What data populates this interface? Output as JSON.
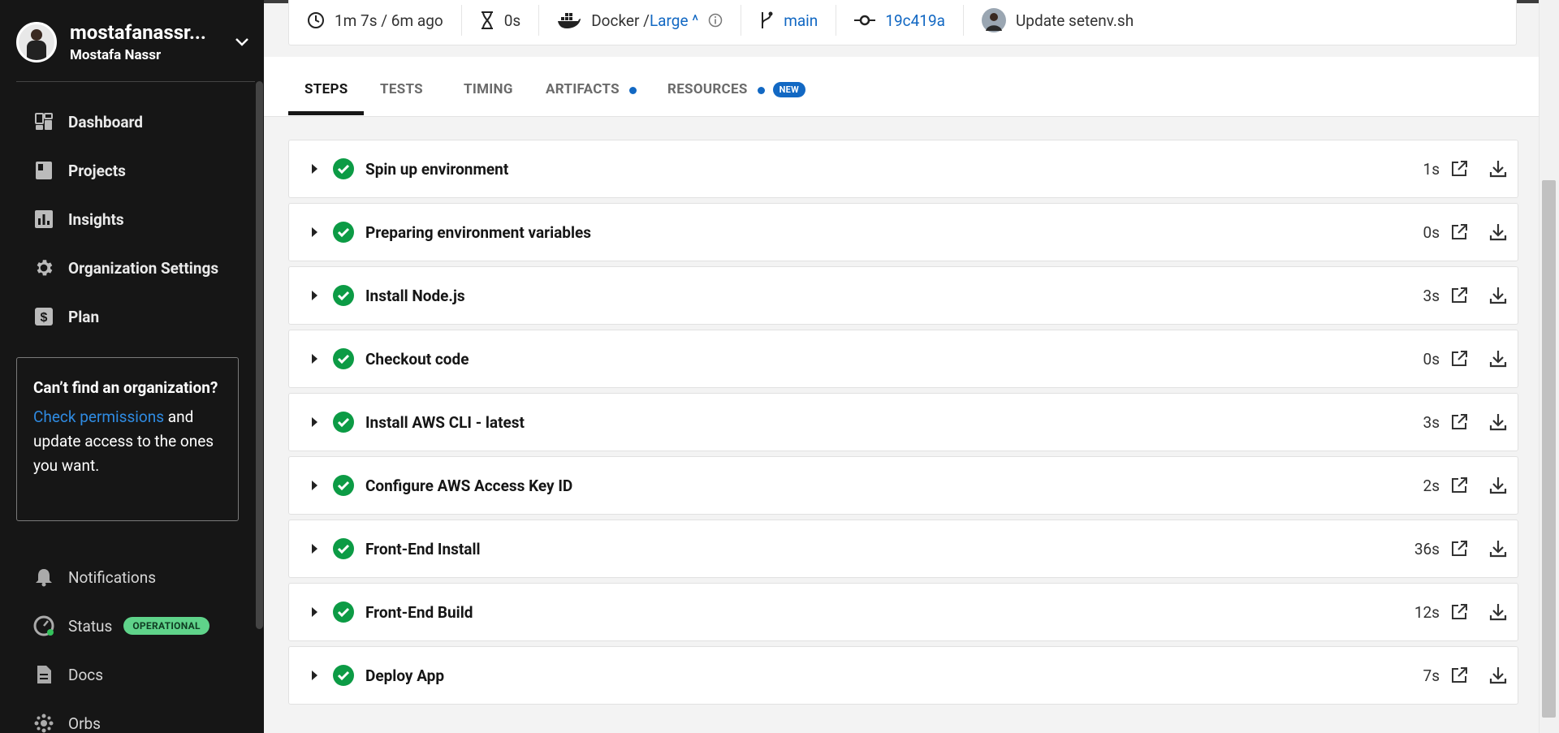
{
  "org": {
    "name": "mostafanassr...",
    "user": "Mostafa Nassr"
  },
  "nav": {
    "items": [
      {
        "label": "Dashboard",
        "icon": "dashboard-icon"
      },
      {
        "label": "Projects",
        "icon": "projects-icon"
      },
      {
        "label": "Insights",
        "icon": "insights-icon"
      },
      {
        "label": "Organization Settings",
        "icon": "gear-icon"
      },
      {
        "label": "Plan",
        "icon": "dollar-icon"
      }
    ],
    "bottom": [
      {
        "label": "Notifications",
        "icon": "bell-icon"
      },
      {
        "label": "Status",
        "icon": "gauge-icon",
        "badge": "OPERATIONAL"
      },
      {
        "label": "Docs",
        "icon": "document-icon"
      },
      {
        "label": "Orbs",
        "icon": "orbs-icon"
      }
    ]
  },
  "callout": {
    "title": "Can’t find an organization?",
    "link": "Check permissions",
    "body_suffix": " and update access to the ones you want."
  },
  "header": {
    "duration": "1m 7s / 6m ago",
    "queued": "0s",
    "executor": "Docker / ",
    "resource_class": "Large",
    "resource_suffix": " ^",
    "branch": "main",
    "commit": "19c419a",
    "commit_message": "Update setenv.sh"
  },
  "tabs": [
    {
      "label": "STEPS",
      "active": true
    },
    {
      "label": "TESTS"
    },
    {
      "label": "TIMING"
    },
    {
      "label": "ARTIFACTS",
      "dot": true
    },
    {
      "label": "RESOURCES",
      "dot": true,
      "badge": "NEW"
    }
  ],
  "steps": [
    {
      "label": "Spin up environment",
      "duration": "1s"
    },
    {
      "label": "Preparing environment variables",
      "duration": "0s"
    },
    {
      "label": "Install Node.js",
      "duration": "3s"
    },
    {
      "label": "Checkout code",
      "duration": "0s"
    },
    {
      "label": "Install AWS CLI - latest",
      "duration": "3s"
    },
    {
      "label": "Configure AWS Access Key ID",
      "duration": "2s"
    },
    {
      "label": "Front-End Install",
      "duration": "36s"
    },
    {
      "label": "Front-End Build",
      "duration": "12s"
    },
    {
      "label": "Deploy App",
      "duration": "7s"
    }
  ],
  "colors": {
    "success": "#0c9b45",
    "link": "#1268c3",
    "sidebar": "#161616",
    "operational": "#5fd38a"
  }
}
